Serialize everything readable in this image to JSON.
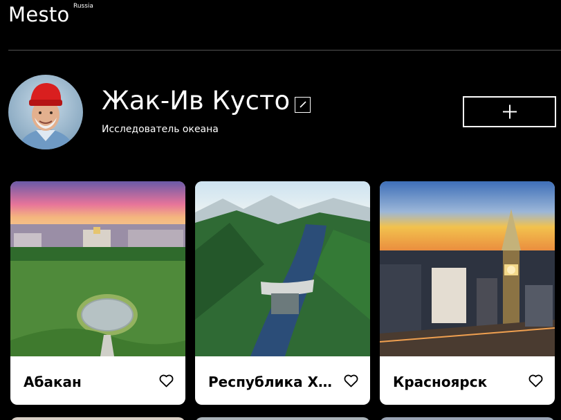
{
  "header": {
    "logo": "Mesto",
    "logo_sup": "Russia"
  },
  "profile": {
    "name": "Жак-Ив Кусто",
    "about": "Исследователь океана"
  },
  "cards": [
    {
      "title": "Абакан"
    },
    {
      "title": "Республика Хакасия"
    },
    {
      "title": "Красноярск"
    }
  ]
}
